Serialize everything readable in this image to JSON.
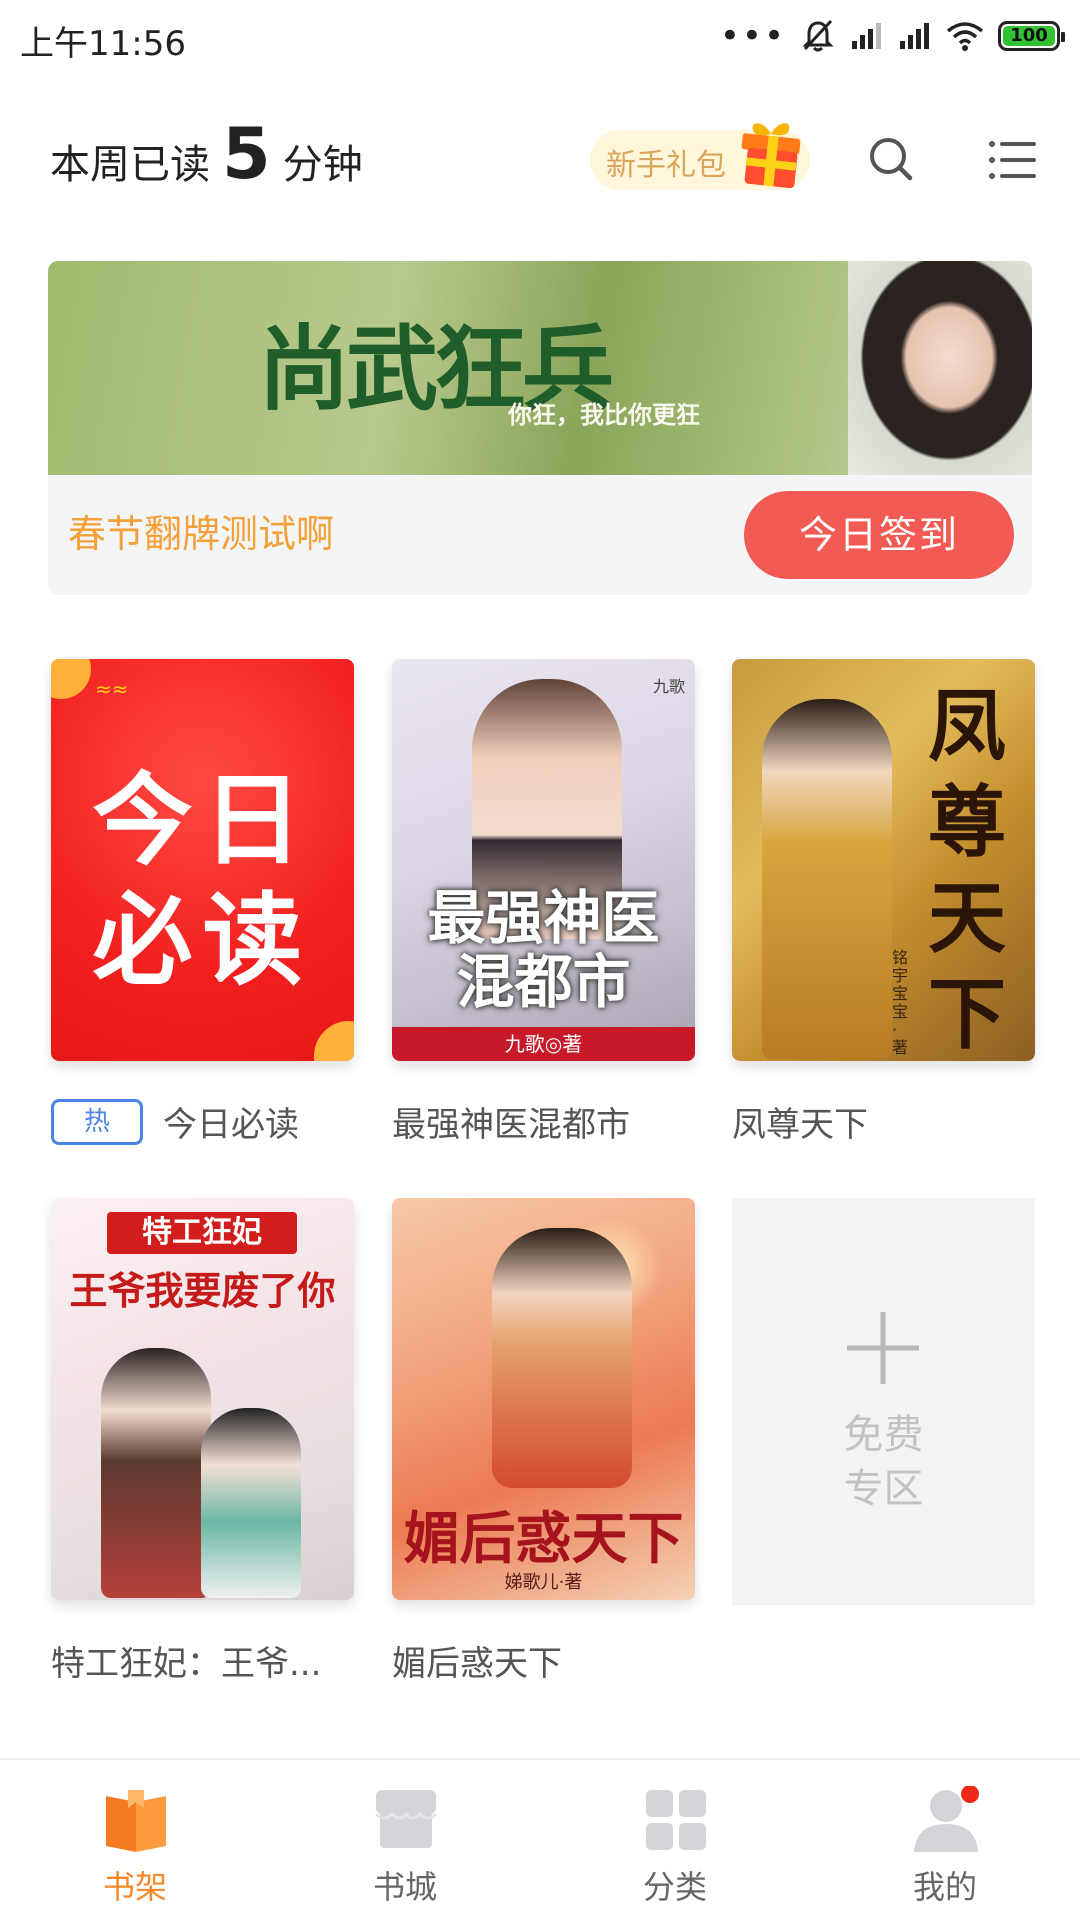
{
  "status_bar": {
    "time": "上午11:56",
    "battery": "100",
    "icons": [
      "more-dots-icon",
      "mute-icon",
      "signal-icon",
      "signal-icon",
      "wifi-icon",
      "battery-icon"
    ]
  },
  "header": {
    "reading_prefix": "本周已读",
    "reading_minutes": "5",
    "reading_suffix": "分钟",
    "gift_label": "新手礼包",
    "icons": [
      "gift-icon",
      "search-icon",
      "menu-list-icon"
    ]
  },
  "banner": {
    "title": "尚武狂兵",
    "subtitle": "你狂，我比你更狂",
    "promo_text": "春节翻牌测试啊",
    "signin_label": "今日签到"
  },
  "books": [
    {
      "title": "今日必读",
      "badge": "热",
      "cover_text_1": "今日",
      "cover_text_2": "必读"
    },
    {
      "title": "最强神医混都市",
      "cover_text_1": "最强神医",
      "cover_text_2": "混都市",
      "cover_author": "九歌◎著",
      "cover_tag": "九歌"
    },
    {
      "title": "凤尊天下",
      "cover_text_1": "凤",
      "cover_text_2": "尊",
      "cover_text_3": "天",
      "cover_text_4": "下",
      "cover_author": "铭宇宝宝·著"
    },
    {
      "title": "特工狂妃：王爷...",
      "cover_text_1": "特工狂妃",
      "cover_text_2": "王爷我要废了你"
    },
    {
      "title": "媚后惑天下",
      "cover_text_1": "媚后惑天下",
      "cover_author": "娣歌儿·著"
    }
  ],
  "free_zone": {
    "line1": "免费",
    "line2": "专区"
  },
  "tabbar": {
    "items": [
      {
        "label": "书架",
        "active": true
      },
      {
        "label": "书城",
        "active": false
      },
      {
        "label": "分类",
        "active": false
      },
      {
        "label": "我的",
        "active": false
      }
    ]
  },
  "colors": {
    "accent": "#f5892c",
    "signin": "#f25a54",
    "promo": "#f4a13a",
    "hot_badge": "#4a84e6",
    "notify_dot": "#f02a1a"
  }
}
